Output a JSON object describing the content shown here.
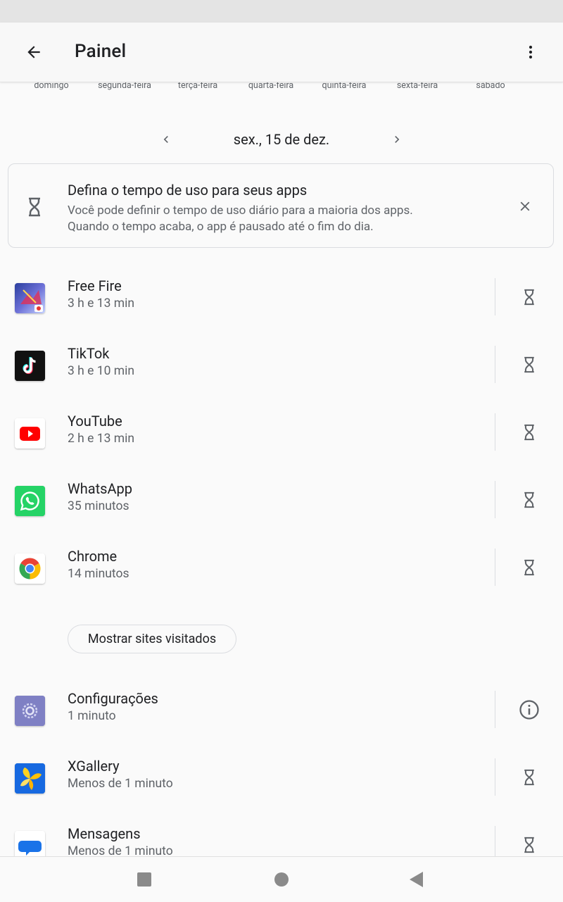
{
  "app_bar": {
    "title": "Painel",
    "back_icon": "arrow-back-icon",
    "overflow_icon": "more-vert-icon"
  },
  "week_days": [
    "domingo",
    "segunda-feira",
    "terça-feira",
    "quarta-feira",
    "quinta-feira",
    "sexta-feira",
    "sábado"
  ],
  "date_nav": {
    "label": "sex., 15 de dez.",
    "prev_icon": "chevron-left-icon",
    "next_icon": "chevron-right-icon"
  },
  "suggestion_card": {
    "title": "Defina o tempo de uso para seus apps",
    "body": "Você pode definir o tempo de uso diário para a maioria dos apps. Quando o tempo acaba, o app é pausado até o fim do dia.",
    "icon": "hourglass-icon",
    "close_icon": "close-icon"
  },
  "apps": [
    {
      "name": "Free Fire",
      "time": "3 h e 13 min",
      "action_icon": "hourglass-icon"
    },
    {
      "name": "TikTok",
      "time": "3 h e 10 min",
      "action_icon": "hourglass-icon"
    },
    {
      "name": "YouTube",
      "time": "2 h e 13 min",
      "action_icon": "hourglass-icon"
    },
    {
      "name": "WhatsApp",
      "time": "35 minutos",
      "action_icon": "hourglass-icon"
    },
    {
      "name": "Chrome",
      "time": "14 minutos",
      "action_icon": "hourglass-icon"
    }
  ],
  "show_sites_button": "Mostrar sites visitados",
  "apps_more": [
    {
      "name": "Configurações",
      "time": "1 minuto",
      "action_icon": "info-icon"
    },
    {
      "name": "XGallery",
      "time": "Menos de 1 minuto",
      "action_icon": "hourglass-icon"
    },
    {
      "name": "Mensagens",
      "time": "Menos de 1 minuto",
      "action_icon": "hourglass-icon"
    }
  ],
  "colors": {
    "text_primary": "#202124",
    "text_secondary": "#5f6368",
    "divider": "#dadce0",
    "icon_gray": "#5f6368"
  }
}
